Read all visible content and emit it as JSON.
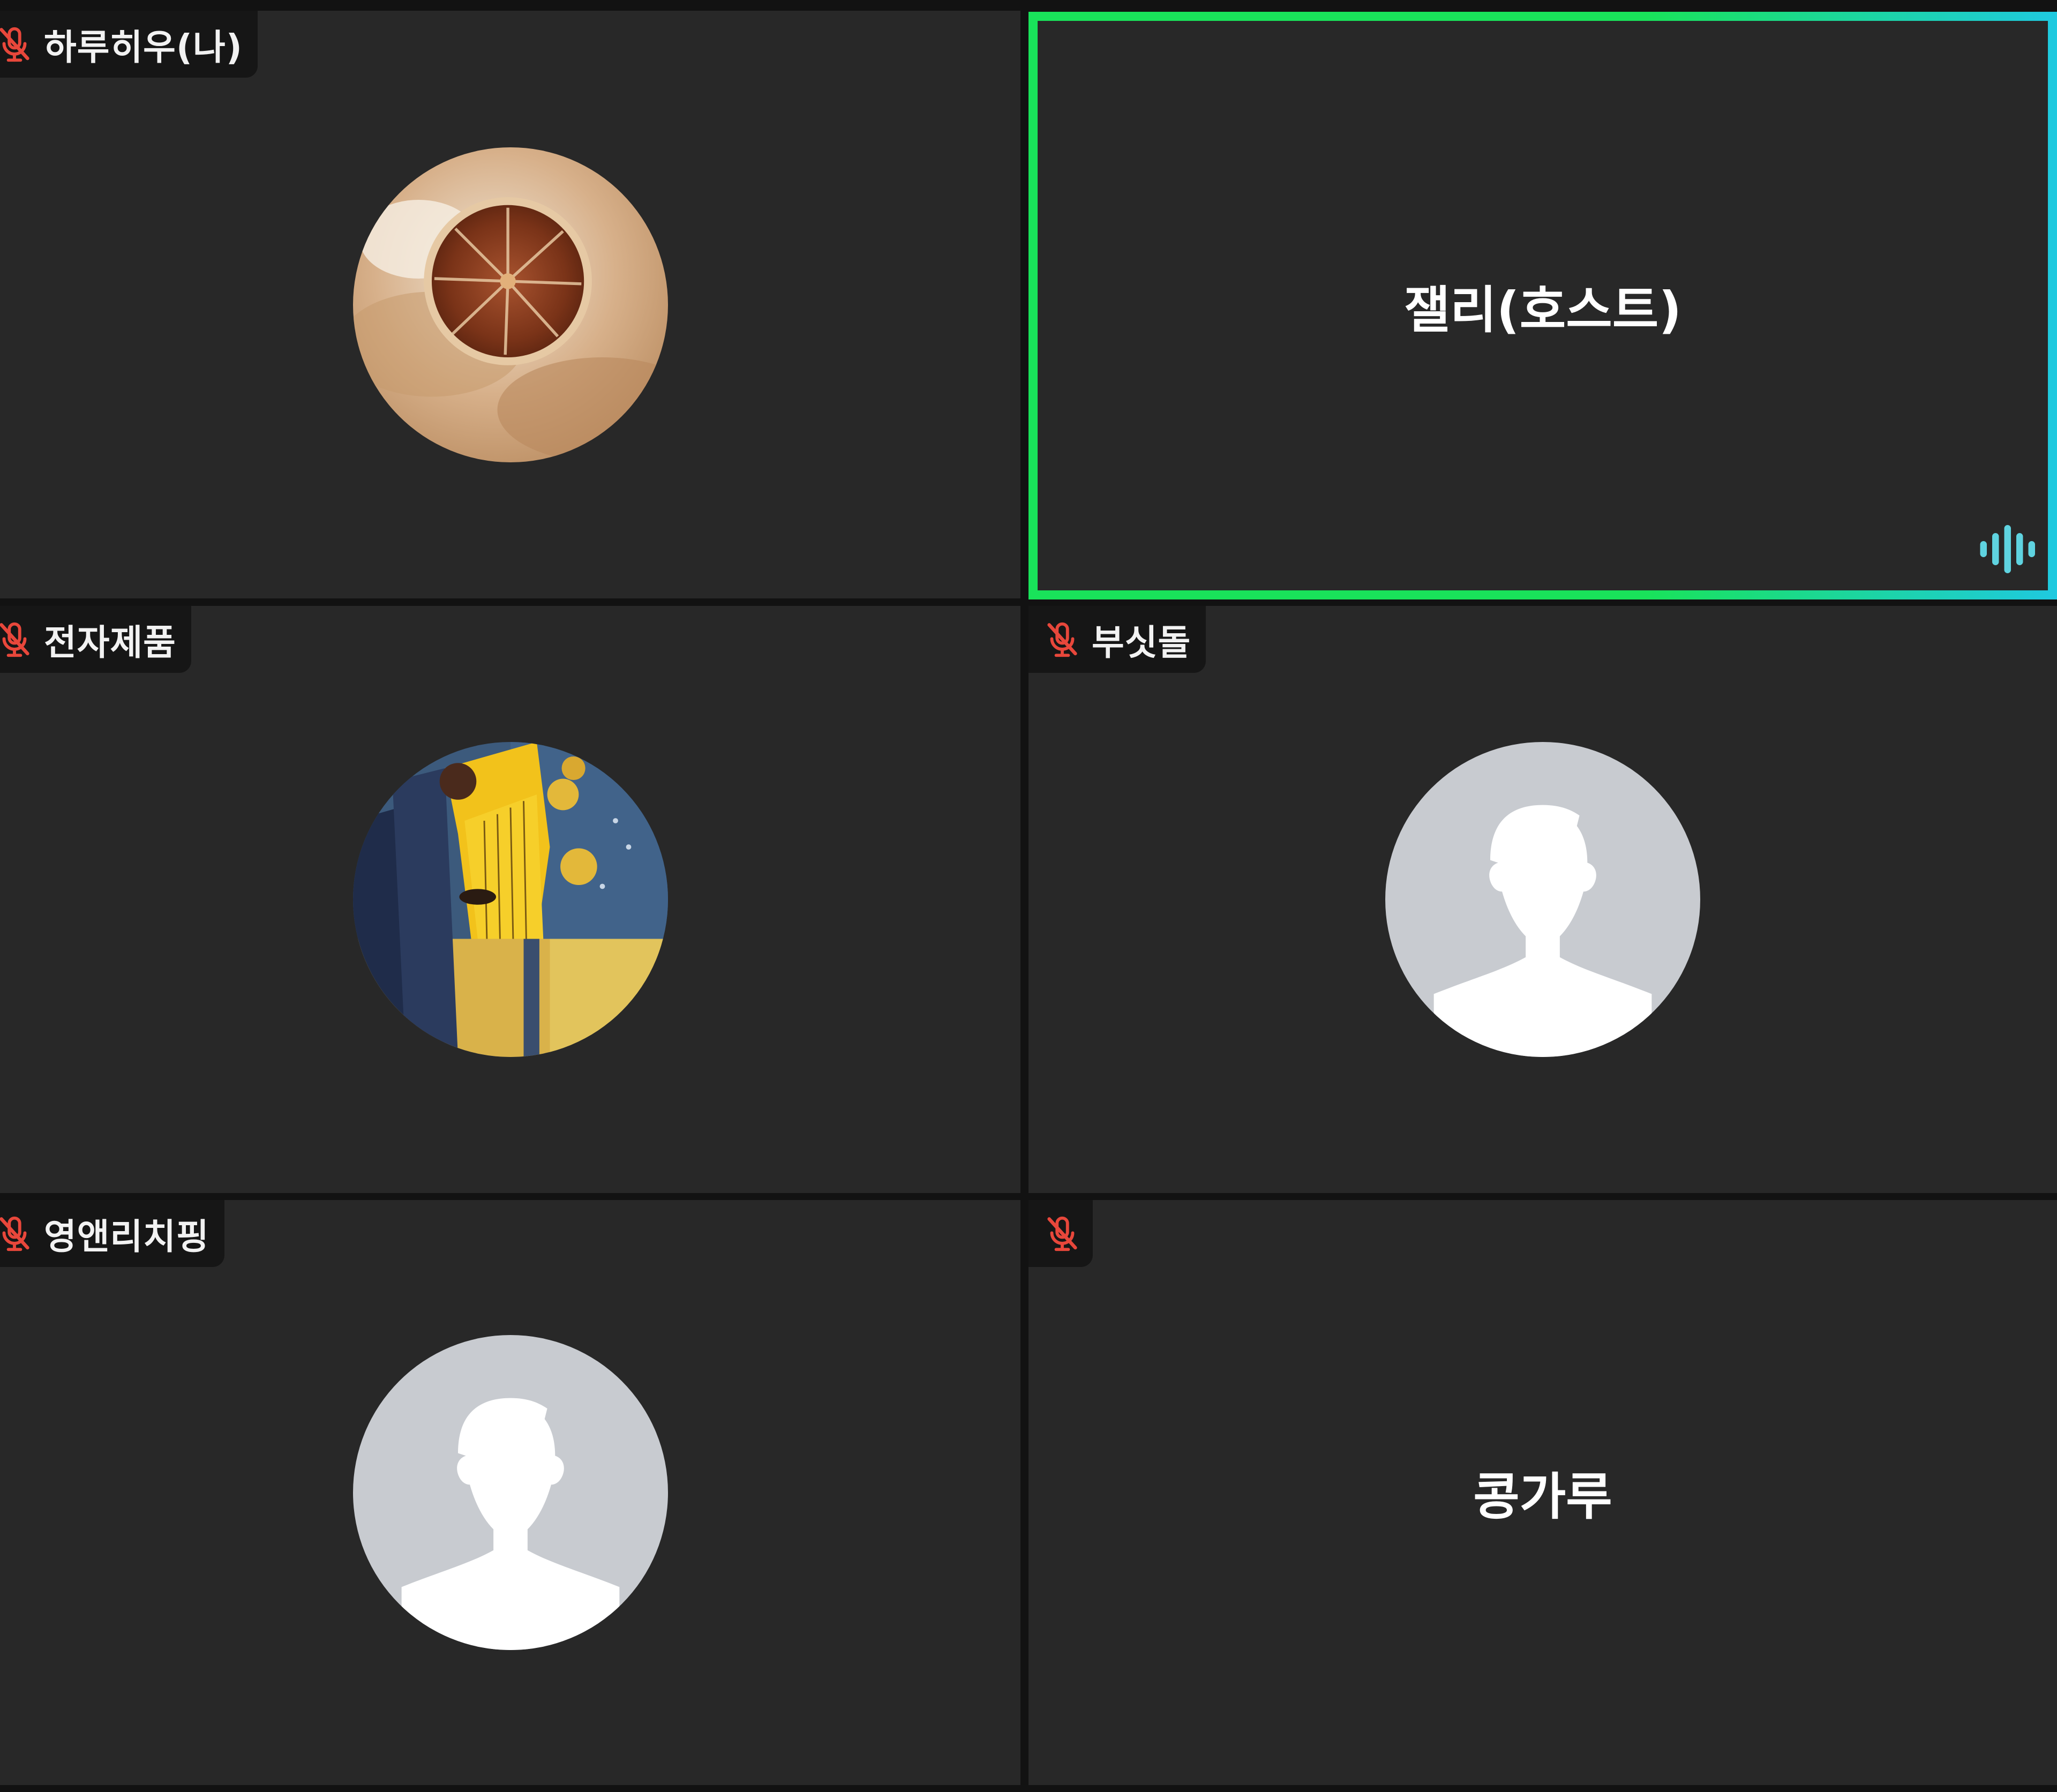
{
  "participants": [
    {
      "name": "하루히우(나)",
      "muted": true,
      "avatar": "dried-orange-photo"
    },
    {
      "name": "잴리(호스트)",
      "muted": false,
      "speaking": true,
      "avatar": "none"
    },
    {
      "name": "전자제품",
      "muted": true,
      "avatar": "golden-harp-painting"
    },
    {
      "name": "부싯돌",
      "muted": true,
      "avatar": "default-silhouette"
    },
    {
      "name": "영앤리치핑",
      "muted": true,
      "avatar": "default-silhouette"
    },
    {
      "name": "콩가루",
      "muted": true,
      "avatar": "none"
    }
  ],
  "colors": {
    "tile_bg": "#282828",
    "gap": "#121212",
    "speaking_border_start": "#19e35a",
    "speaking_border_end": "#1fc9e0",
    "mic_muted": "#e8473b",
    "audio_wave": "#5fd3e0",
    "avatar_default_bg": "#c8cbd0"
  },
  "icons": {
    "muted_mic": "mic-off-icon",
    "speaking": "audio-wave-icon"
  }
}
